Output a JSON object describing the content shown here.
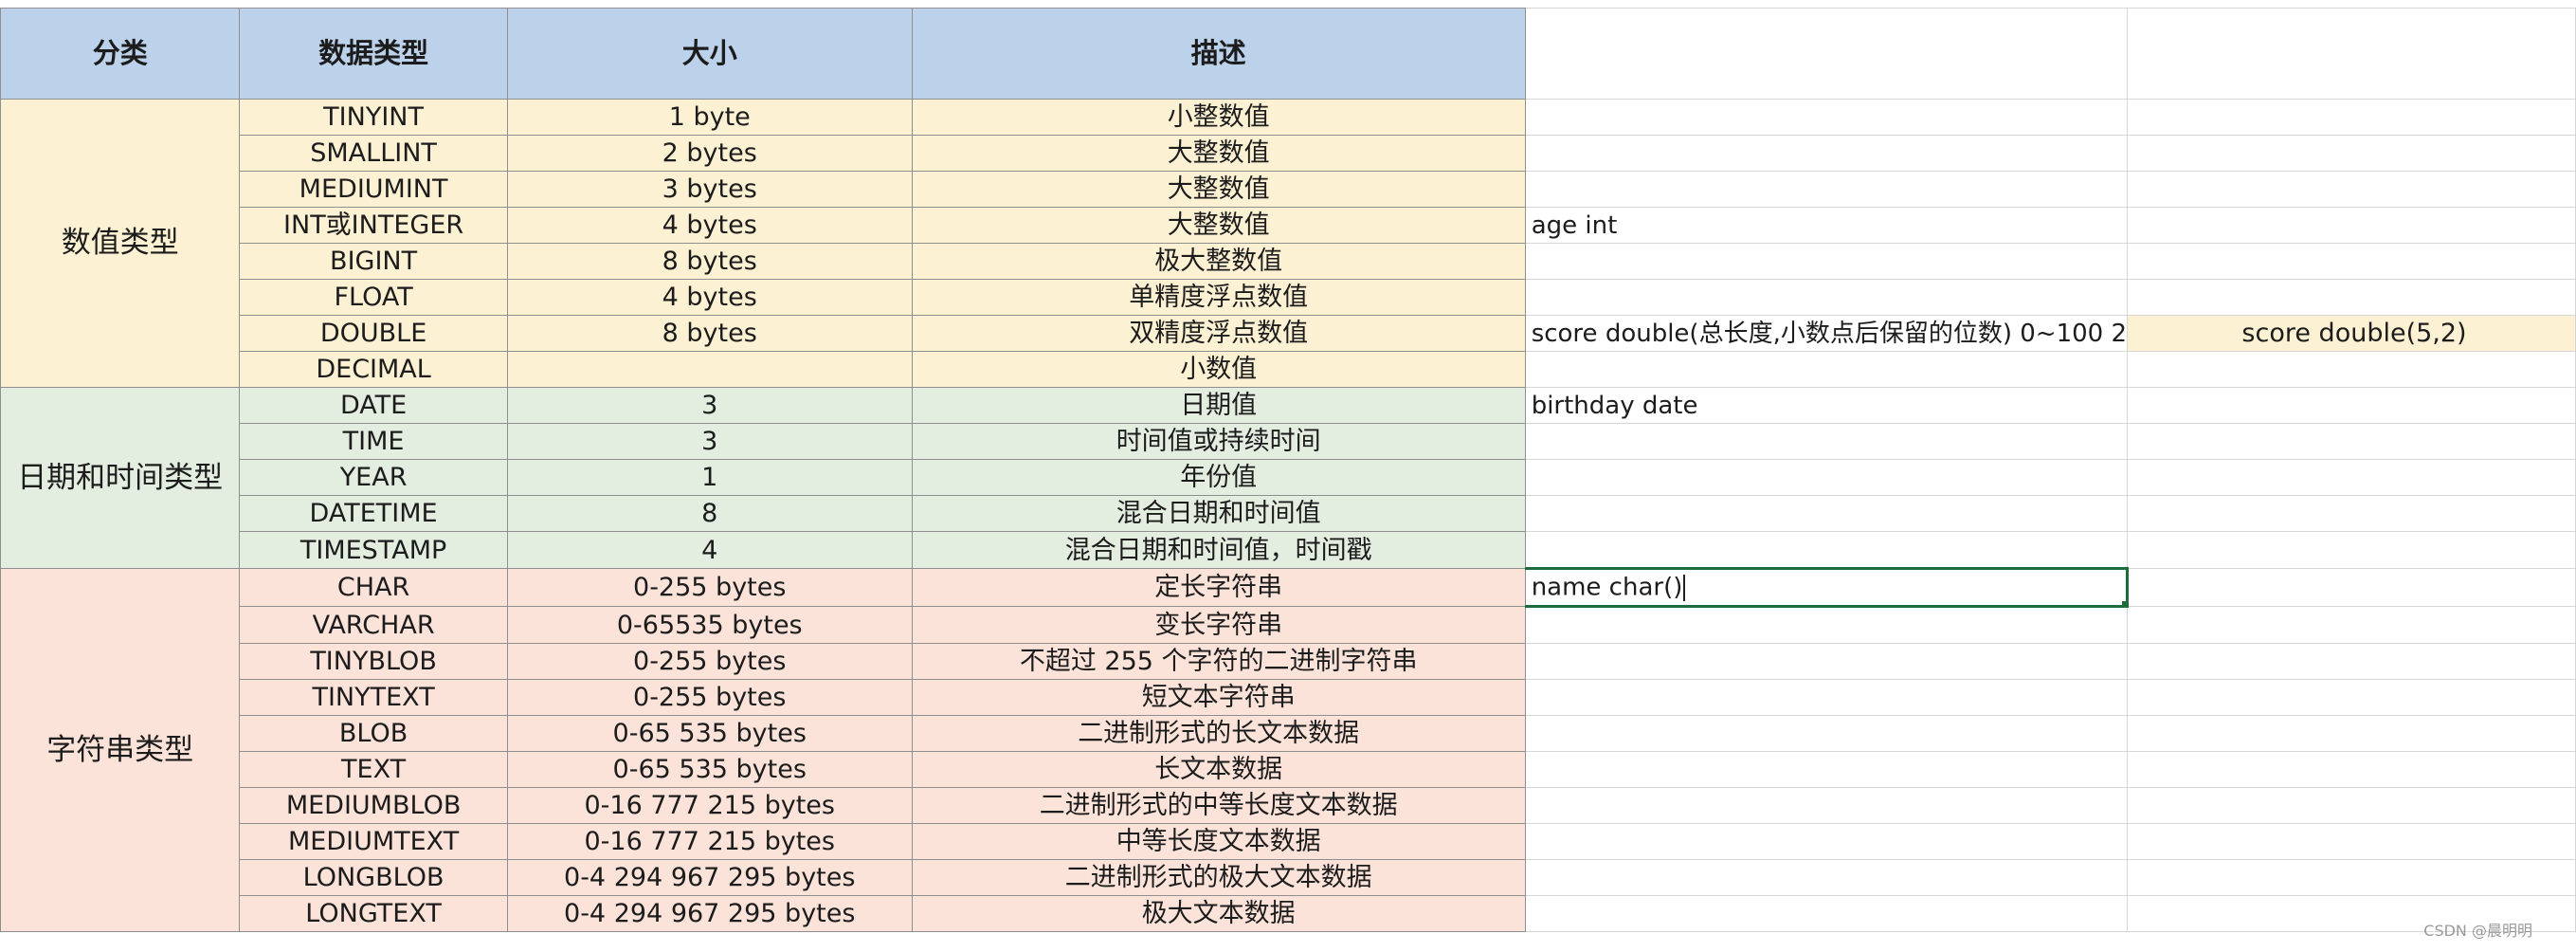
{
  "header": {
    "category": "分类",
    "data_type": "数据类型",
    "size": "大小",
    "description": "描述"
  },
  "categories": {
    "numeric": "数值类型",
    "datetime": "日期和时间类型",
    "string": "字符串类型"
  },
  "rows": [
    {
      "type": "TINYINT",
      "size": "1 byte",
      "desc": "小整数值",
      "note": ""
    },
    {
      "type": "SMALLINT",
      "size": "2 bytes",
      "desc": "大整数值",
      "note": ""
    },
    {
      "type": "MEDIUMINT",
      "size": "3 bytes",
      "desc": "大整数值",
      "note": ""
    },
    {
      "type": "INT或INTEGER",
      "size": "4 bytes",
      "desc": "大整数值",
      "note": "age int"
    },
    {
      "type": "BIGINT",
      "size": "8 bytes",
      "desc": "极大整数值",
      "note": ""
    },
    {
      "type": "FLOAT",
      "size": "4 bytes",
      "desc": "单精度浮点数值",
      "note": ""
    },
    {
      "type": "DOUBLE",
      "size": "8 bytes",
      "desc": "双精度浮点数值",
      "note": "score double(总长度,小数点后保留的位数)  0~100 2",
      "extra": "score double(5,2)"
    },
    {
      "type": "DECIMAL",
      "size": "",
      "desc": "小数值",
      "note": ""
    },
    {
      "type": "DATE",
      "size": "3",
      "desc": "日期值",
      "note": "birthday date"
    },
    {
      "type": "TIME",
      "size": "3",
      "desc": "时间值或持续时间",
      "note": ""
    },
    {
      "type": "YEAR",
      "size": "1",
      "desc": "年份值",
      "note": ""
    },
    {
      "type": "DATETIME",
      "size": "8",
      "desc": "混合日期和时间值",
      "note": ""
    },
    {
      "type": "TIMESTAMP",
      "size": "4",
      "desc": "混合日期和时间值，时间戳",
      "note": ""
    },
    {
      "type": "CHAR",
      "size": "0-255 bytes",
      "desc": "定长字符串",
      "note": "name char()"
    },
    {
      "type": "VARCHAR",
      "size": "0-65535 bytes",
      "desc": "变长字符串",
      "note": ""
    },
    {
      "type": "TINYBLOB",
      "size": "0-255 bytes",
      "desc": "不超过 255 个字符的二进制字符串",
      "note": ""
    },
    {
      "type": "TINYTEXT",
      "size": "0-255 bytes",
      "desc": "短文本字符串",
      "note": ""
    },
    {
      "type": "BLOB",
      "size": "0-65 535 bytes",
      "desc": "二进制形式的长文本数据",
      "note": ""
    },
    {
      "type": "TEXT",
      "size": "0-65 535 bytes",
      "desc": "长文本数据",
      "note": ""
    },
    {
      "type": "MEDIUMBLOB",
      "size": "0-16 777 215 bytes",
      "desc": "二进制形式的中等长度文本数据",
      "note": ""
    },
    {
      "type": "MEDIUMTEXT",
      "size": "0-16 777 215 bytes",
      "desc": "中等长度文本数据",
      "note": ""
    },
    {
      "type": "LONGBLOB",
      "size": "0-4 294 967 295 bytes",
      "desc": "二进制形式的极大文本数据",
      "note": ""
    },
    {
      "type": "LONGTEXT",
      "size": "0-4 294 967 295 bytes",
      "desc": "极大文本数据",
      "note": ""
    }
  ],
  "watermark": "CSDN @晨明明",
  "colors": {
    "header": "#bcd1ea",
    "numeric": "#fdf1d3",
    "datetime": "#e3ede0",
    "string": "#fbe3da",
    "active_border": "#1e6b3b"
  }
}
